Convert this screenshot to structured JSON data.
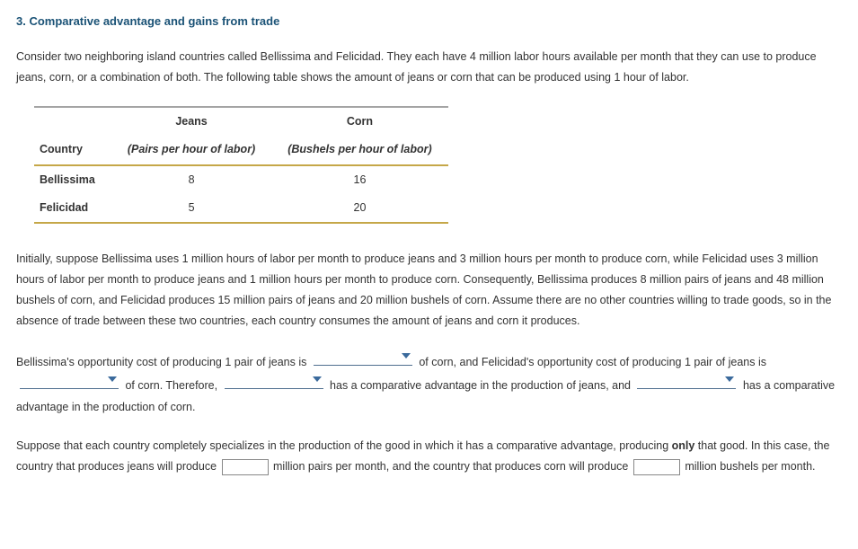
{
  "heading": "3. Comparative advantage and gains from trade",
  "intro": "Consider two neighboring island countries called Bellissima and Felicidad. They each have 4 million labor hours available per month that they can use to produce jeans, corn, or a combination of both. The following table shows the amount of jeans or corn that can be produced using 1 hour of labor.",
  "table": {
    "col_country": "Country",
    "col_jeans": "Jeans",
    "col_corn": "Corn",
    "sub_jeans": "(Pairs per hour of labor)",
    "sub_corn": "(Bushels per hour of labor)",
    "rows": [
      {
        "name": "Bellissima",
        "jeans": "8",
        "corn": "16"
      },
      {
        "name": "Felicidad",
        "jeans": "5",
        "corn": "20"
      }
    ]
  },
  "para2": "Initially, suppose Bellissima uses 1 million hours of labor per month to produce jeans and 3 million hours per month to produce corn, while Felicidad uses 3 million hours of labor per month to produce jeans and 1 million hours per month to produce corn. Consequently, Bellissima produces 8 million pairs of jeans and 48 million bushels of corn, and Felicidad produces 15 million pairs of jeans and 20 million bushels of corn. Assume there are no other countries willing to trade goods, so in the absence of trade between these two countries, each country consumes the amount of jeans and corn it produces.",
  "fill": {
    "t1": "Bellissima's opportunity cost of producing 1 pair of jeans is ",
    "t2": " of corn, and Felicidad's opportunity cost of producing 1 pair of jeans is ",
    "t3": " of corn. Therefore, ",
    "t4": " has a comparative advantage in the production of jeans, and ",
    "t5": " has a comparative advantage in the production of corn."
  },
  "spec": {
    "t1": "Suppose that each country completely specializes in the production of the good in which it has a comparative advantage, producing ",
    "only": "only",
    "t2": " that good. In this case, the country that produces jeans will produce ",
    "t3": " million pairs per month, and the country that produces corn will produce ",
    "t4": " million bushels per month."
  }
}
